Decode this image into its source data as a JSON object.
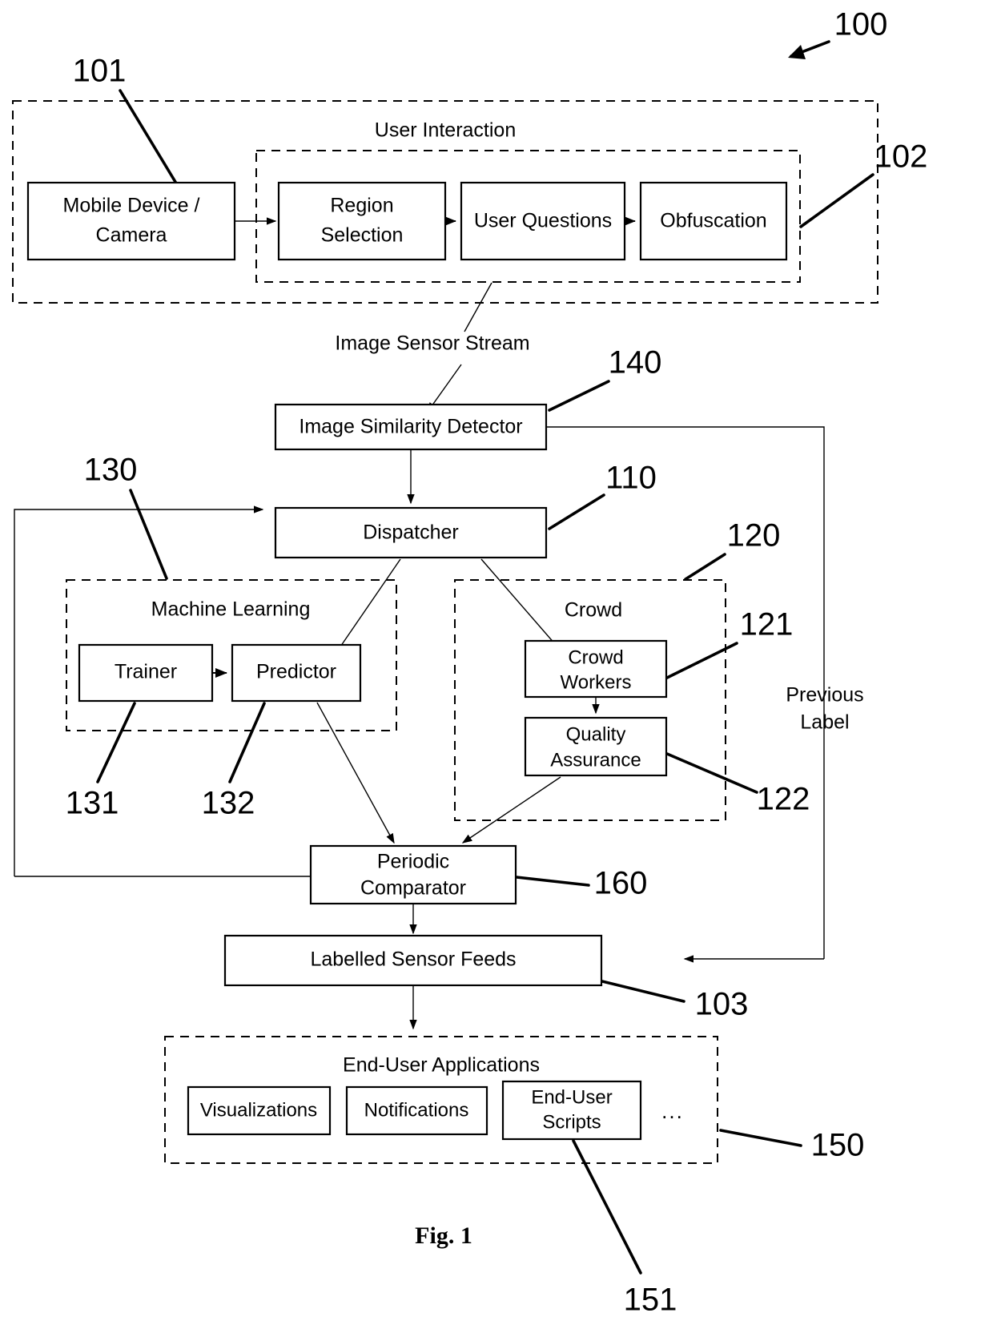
{
  "figure": {
    "caption": "Fig. 1",
    "system_ref": "100"
  },
  "groups": {
    "user_interaction": {
      "label": "User Interaction",
      "ref": "101"
    },
    "user_interaction_inner": {
      "ref": "102"
    },
    "machine_learning": {
      "label": "Machine Learning",
      "ref": "130"
    },
    "crowd": {
      "label": "Crowd",
      "ref": "120"
    },
    "end_user_applications": {
      "label": "End-User Applications",
      "ref": "150"
    }
  },
  "blocks": {
    "mobile_device": {
      "line1": "Mobile Device /",
      "line2": "Camera"
    },
    "region_selection": {
      "line1": "Region",
      "line2": "Selection"
    },
    "user_questions": {
      "line1": "User Questions"
    },
    "obfuscation": {
      "line1": "Obfuscation",
      "ref": "102"
    },
    "image_similarity_detector": {
      "line1": "Image Similarity Detector",
      "ref": "140"
    },
    "dispatcher": {
      "line1": "Dispatcher",
      "ref": "110"
    },
    "trainer": {
      "line1": "Trainer",
      "ref": "131"
    },
    "predictor": {
      "line1": "Predictor",
      "ref": "132"
    },
    "crowd_workers": {
      "line1": "Crowd",
      "line2": "Workers",
      "ref": "121"
    },
    "quality_assurance": {
      "line1": "Quality",
      "line2": "Assurance",
      "ref": "122"
    },
    "periodic_comparator": {
      "line1": "Periodic",
      "line2": "Comparator",
      "ref": "160"
    },
    "labelled_sensor_feeds": {
      "line1": "Labelled Sensor Feeds",
      "ref": "103"
    },
    "visualizations": {
      "line1": "Visualizations"
    },
    "notifications": {
      "line1": "Notifications"
    },
    "end_user_scripts": {
      "line1": "End-User",
      "line2": "Scripts",
      "ref": "151"
    },
    "more_apps": {
      "line1": "..."
    }
  },
  "edge_labels": {
    "image_sensor_stream": "Image Sensor Stream",
    "previous_label_line1": "Previous",
    "previous_label_line2": "Label"
  },
  "colors": {
    "stroke": "#000000",
    "fill": "#ffffff"
  }
}
